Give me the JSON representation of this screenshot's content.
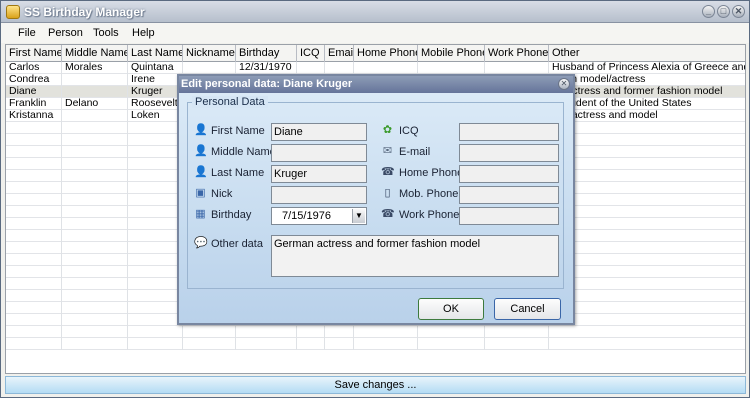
{
  "app": {
    "title": "SS Birthday Manager",
    "window_buttons": [
      "_",
      "□",
      "✕"
    ]
  },
  "menu": [
    "File",
    "Person",
    "Tools",
    "Help"
  ],
  "grid": {
    "columns": [
      "First Name",
      "Middle Name",
      "Last Name",
      "Nickname",
      "Birthday",
      "ICQ",
      "Email",
      "Home Phone",
      "Mobile Phone",
      "Work Phone",
      "Other"
    ],
    "rows": [
      [
        "Carlos",
        "Morales",
        "Quintana",
        "",
        "12/31/1970",
        "",
        "",
        "",
        "",
        "",
        "Husband of Princess Alexia of Greece and ..."
      ],
      [
        "Condrea",
        "",
        "Irene",
        "",
        "",
        "",
        "",
        "",
        "",
        "",
        "avian model/actress"
      ],
      [
        "Diane",
        "",
        "Kruger",
        "",
        "",
        "",
        "",
        "",
        "",
        "",
        "an actress and former fashion model"
      ],
      [
        "Franklin",
        "Delano",
        "Roosevelt",
        "",
        "",
        "",
        "",
        "",
        "",
        "",
        "President of the United States"
      ],
      [
        "Kristanna",
        "",
        "Loken",
        "",
        "",
        "",
        "",
        "",
        "",
        "",
        "can actress and model"
      ]
    ],
    "selected_row": 2
  },
  "save_bar": "Save changes ...",
  "dialog": {
    "title": "Edit personal data: Diane  Kruger",
    "group": "Personal Data",
    "fields": {
      "first_name": {
        "label": "First Name",
        "value": "Diane"
      },
      "middle_name": {
        "label": "Middle Name",
        "value": ""
      },
      "last_name": {
        "label": "Last Name",
        "value": "Kruger"
      },
      "nick": {
        "label": "Nick",
        "value": ""
      },
      "birthday": {
        "label": "Birthday",
        "value": "7/15/1976"
      },
      "icq": {
        "label": "ICQ",
        "value": ""
      },
      "email": {
        "label": "E-mail",
        "value": ""
      },
      "home_phone": {
        "label": "Home Phone",
        "value": ""
      },
      "mob_phone": {
        "label": "Mob. Phone",
        "value": ""
      },
      "work_phone": {
        "label": "Work Phone",
        "value": ""
      },
      "other": {
        "label": "Other data",
        "value": "German actress and former fashion model"
      }
    },
    "ok": "OK",
    "cancel": "Cancel",
    "close_glyph": "✕"
  },
  "icons": {
    "person": "👤",
    "nick": "▣",
    "birthday": "▦",
    "icq": "✿",
    "email": "✉",
    "phone": "☎",
    "mobile": "▯",
    "other": "💬",
    "combo": "▼"
  }
}
